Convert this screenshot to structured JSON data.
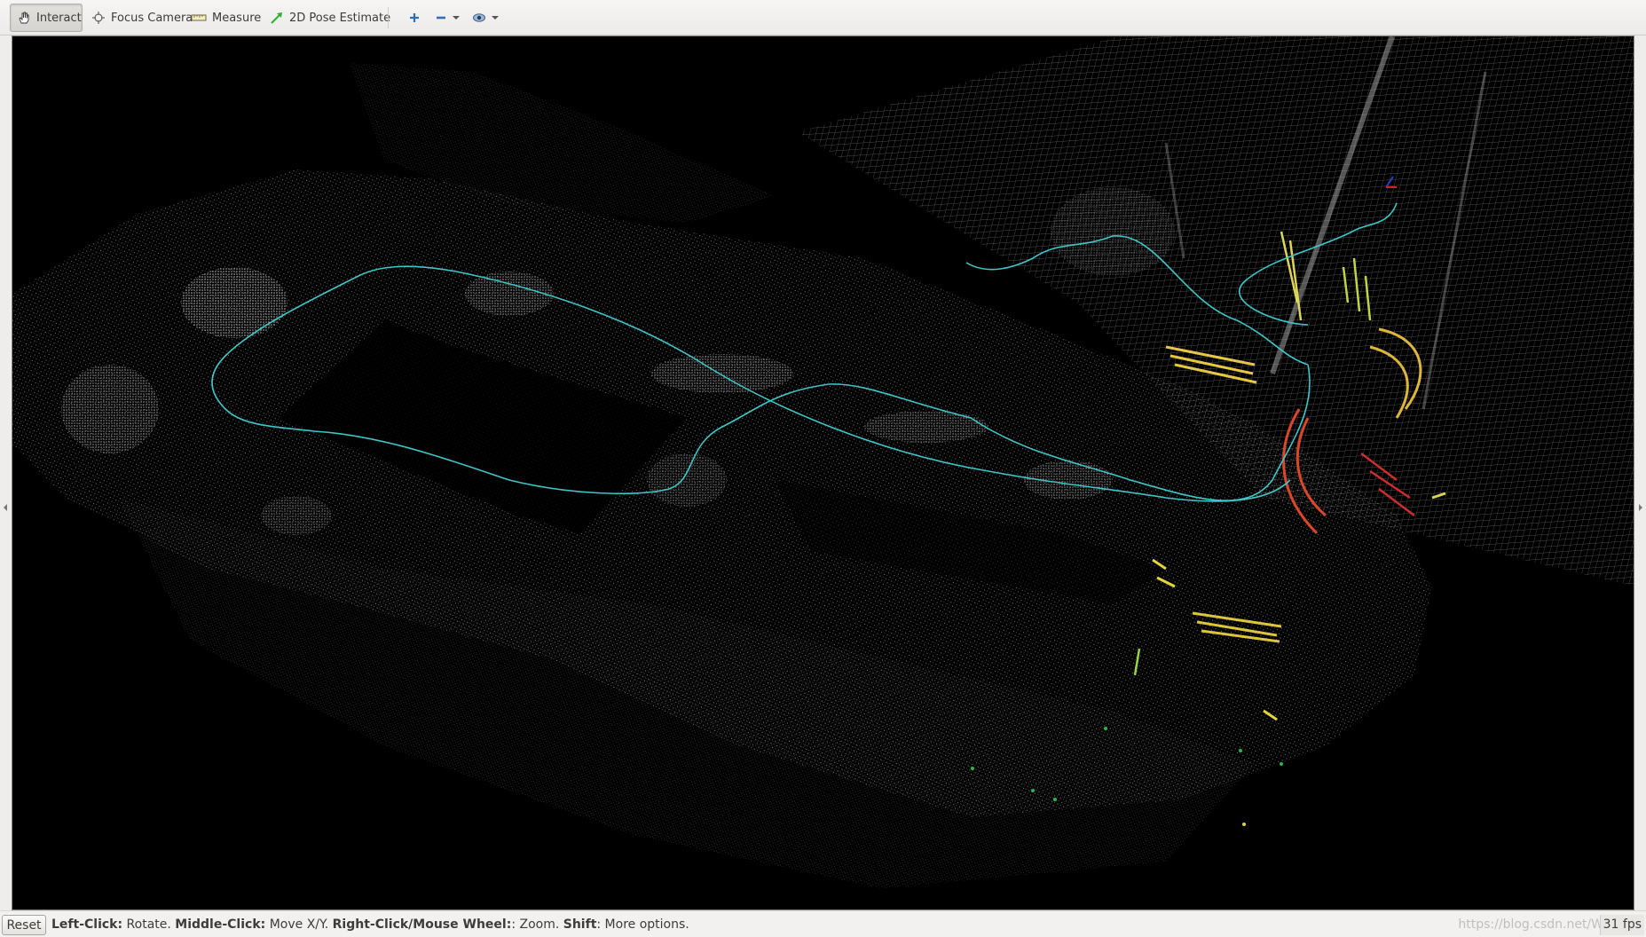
{
  "toolbar": {
    "tools": [
      {
        "label": "Interact",
        "icon": "hand-icon",
        "active": true
      },
      {
        "label": "Focus Camera",
        "icon": "crosshair-icon",
        "active": false
      },
      {
        "label": "Measure",
        "icon": "ruler-icon",
        "active": false
      },
      {
        "label": "2D Pose Estimate",
        "icon": "green-arrow-icon",
        "active": false
      }
    ],
    "add_icon": "plus-icon",
    "remove_icon": "minus-icon",
    "panels_icon": "eye-icon"
  },
  "statusbar": {
    "reset_label": "Reset",
    "hint": [
      {
        "key": "Left-Click:",
        "text": " Rotate. "
      },
      {
        "key": "Middle-Click:",
        "text": " Move X/Y. "
      },
      {
        "key": "Right-Click/Mouse Wheel:",
        "text": ": Zoom. "
      },
      {
        "key": "Shift",
        "text": ": More options."
      }
    ],
    "fps": "31 fps",
    "watermark": "https://blog.csdn.net/W"
  },
  "colors": {
    "background": "#000000",
    "trajectory": "#3ec6c8",
    "grid": "#8c8c8c",
    "point_cloud": "#d8d8d8"
  }
}
